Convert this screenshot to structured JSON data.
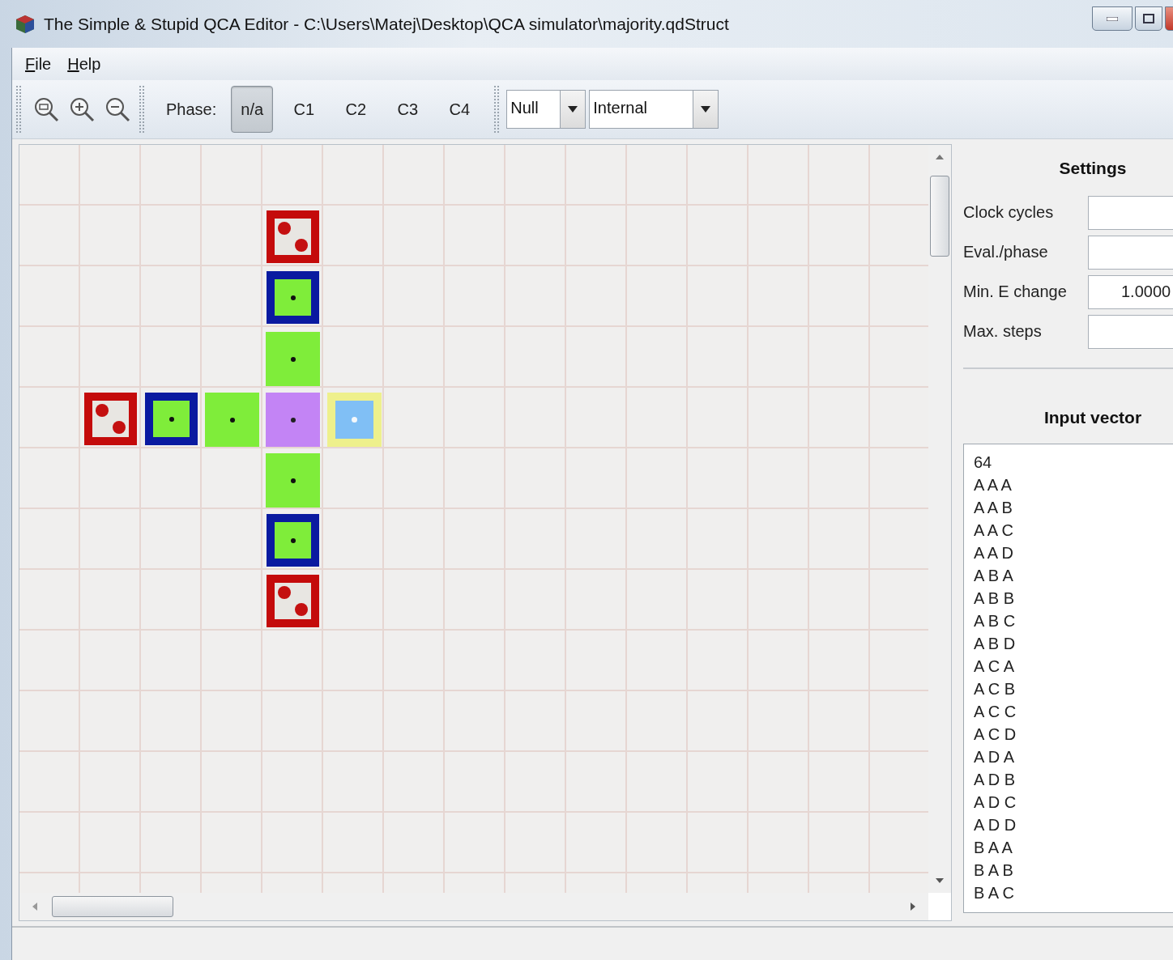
{
  "window": {
    "title": "The Simple & Stupid QCA Editor - C:\\Users\\Matej\\Desktop\\QCA simulator\\majority.qdStruct"
  },
  "menu": [
    {
      "label": "File"
    },
    {
      "label": "Help"
    }
  ],
  "toolbar": {
    "phase_label": "Phase:",
    "phases": [
      {
        "label": "n/a",
        "selected": true
      },
      {
        "label": "C1",
        "selected": false
      },
      {
        "label": "C2",
        "selected": false
      },
      {
        "label": "C3",
        "selected": false
      },
      {
        "label": "C4",
        "selected": false
      }
    ],
    "dropdowns": [
      {
        "value": "Null"
      },
      {
        "value": "Internal"
      }
    ]
  },
  "circuit": [
    {
      "cells": [
        {
          "kind": "empty"
        },
        {
          "kind": "empty"
        },
        {
          "kind": "empty"
        },
        {
          "kind": "empty"
        },
        {
          "kind": "empty"
        },
        {
          "kind": "empty"
        }
      ]
    },
    {
      "cells": [
        {
          "kind": "empty"
        },
        {
          "kind": "empty"
        },
        {
          "kind": "empty"
        },
        {
          "kind": "empty"
        },
        {
          "kind": "fixed"
        },
        {
          "kind": "empty"
        }
      ]
    },
    {
      "cells": [
        {
          "kind": "empty"
        },
        {
          "kind": "empty"
        },
        {
          "kind": "empty"
        },
        {
          "kind": "empty"
        },
        {
          "kind": "input"
        },
        {
          "kind": "empty"
        }
      ]
    },
    {
      "cells": [
        {
          "kind": "empty"
        },
        {
          "kind": "empty"
        },
        {
          "kind": "empty"
        },
        {
          "kind": "empty"
        },
        {
          "kind": "normal"
        },
        {
          "kind": "empty"
        }
      ]
    },
    {
      "cells": [
        {
          "kind": "empty"
        },
        {
          "kind": "fixed"
        },
        {
          "kind": "input"
        },
        {
          "kind": "normal"
        },
        {
          "kind": "majority"
        },
        {
          "kind": "output"
        }
      ]
    },
    {
      "cells": [
        {
          "kind": "empty"
        },
        {
          "kind": "empty"
        },
        {
          "kind": "empty"
        },
        {
          "kind": "empty"
        },
        {
          "kind": "normal"
        },
        {
          "kind": "empty"
        }
      ]
    },
    {
      "cells": [
        {
          "kind": "empty"
        },
        {
          "kind": "empty"
        },
        {
          "kind": "empty"
        },
        {
          "kind": "empty"
        },
        {
          "kind": "input"
        },
        {
          "kind": "empty"
        }
      ]
    },
    {
      "cells": [
        {
          "kind": "empty"
        },
        {
          "kind": "empty"
        },
        {
          "kind": "empty"
        },
        {
          "kind": "empty"
        },
        {
          "kind": "fixed"
        },
        {
          "kind": "empty"
        }
      ]
    }
  ],
  "settings": {
    "title": "Settings",
    "fields": [
      {
        "label": "Clock cycles"
      },
      {
        "label": "Eval./phase"
      },
      {
        "label": "Min. E change",
        "value": "1.0000"
      },
      {
        "label": "Max. steps"
      }
    ]
  },
  "input_vector": {
    "title": "Input vector",
    "lines": [
      "64",
      "A A A",
      "A A B",
      "A A C",
      "A A D",
      "A B A",
      "A B B",
      "A B C",
      "A B D",
      "A C A",
      "A C B",
      "A C C",
      "A C D",
      "A D A",
      "A D B",
      "A D C",
      "A D D",
      "B A A",
      "B A B",
      "B A C"
    ]
  }
}
